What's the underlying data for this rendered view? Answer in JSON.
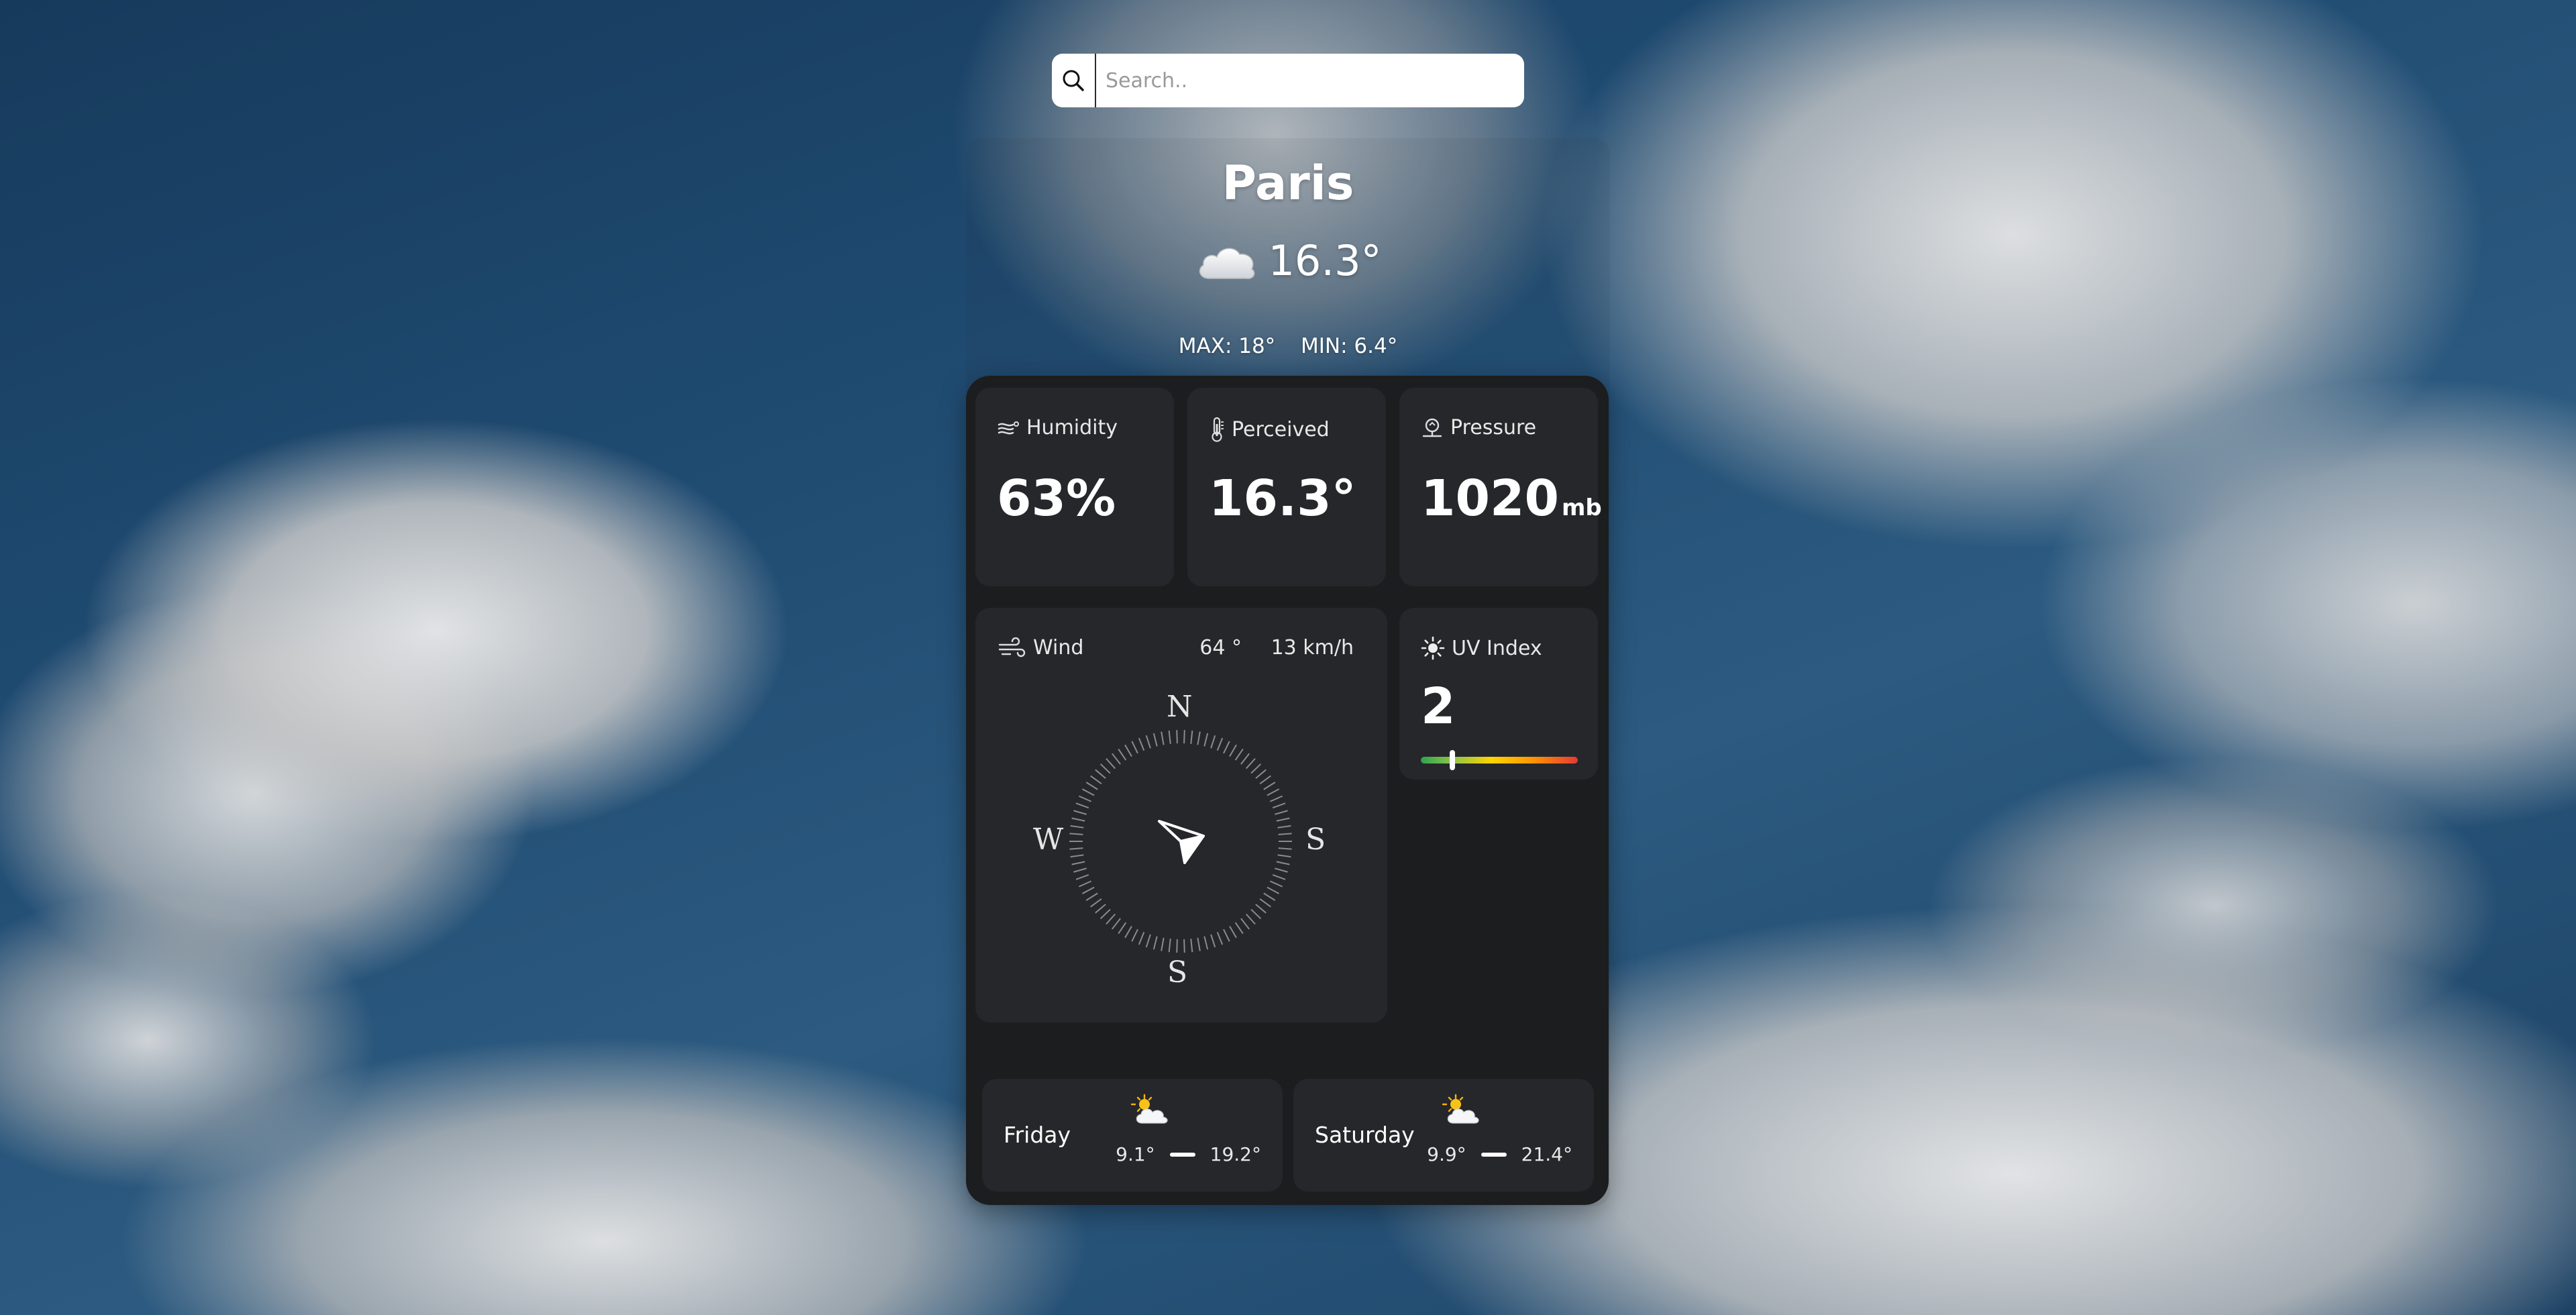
{
  "search": {
    "placeholder": "Search.."
  },
  "location": {
    "city": "Paris"
  },
  "current": {
    "temperature": "16.3°",
    "icon": "cloud-icon"
  },
  "minmax": {
    "max": "MAX: 18°",
    "min": "MIN: 6.4°"
  },
  "tiles": {
    "humidity": {
      "label": "Humidity",
      "value": "63%",
      "icon": "humidity-icon"
    },
    "perceived": {
      "label": "Perceived",
      "value": "16.3°",
      "icon": "thermometer-icon"
    },
    "pressure": {
      "label": "Pressure",
      "value": "1020",
      "unit": "mb",
      "icon": "pressure-icon"
    },
    "wind": {
      "label": "Wind",
      "direction": "64 °",
      "speed": "13 km/h",
      "icon": "wind-icon",
      "compass": {
        "n": "N",
        "e": "S",
        "s": "S",
        "w": "W"
      },
      "arrow_heading_deg": 64
    },
    "uv": {
      "label": "UV Index",
      "value": "2",
      "icon": "sun-icon",
      "level_fraction": 0.2
    }
  },
  "forecast": [
    {
      "day": "Friday",
      "min": "9.1°",
      "max": "19.2°",
      "icon": "partly-cloudy-icon"
    },
    {
      "day": "Saturday",
      "min": "9.9°",
      "max": "21.4°",
      "icon": "partly-cloudy-icon"
    }
  ],
  "colors": {
    "card": "#1c1d1f",
    "tile": "#26272a",
    "uv_gradient": [
      "#2ea44f",
      "#ffd400",
      "#e53935"
    ]
  }
}
